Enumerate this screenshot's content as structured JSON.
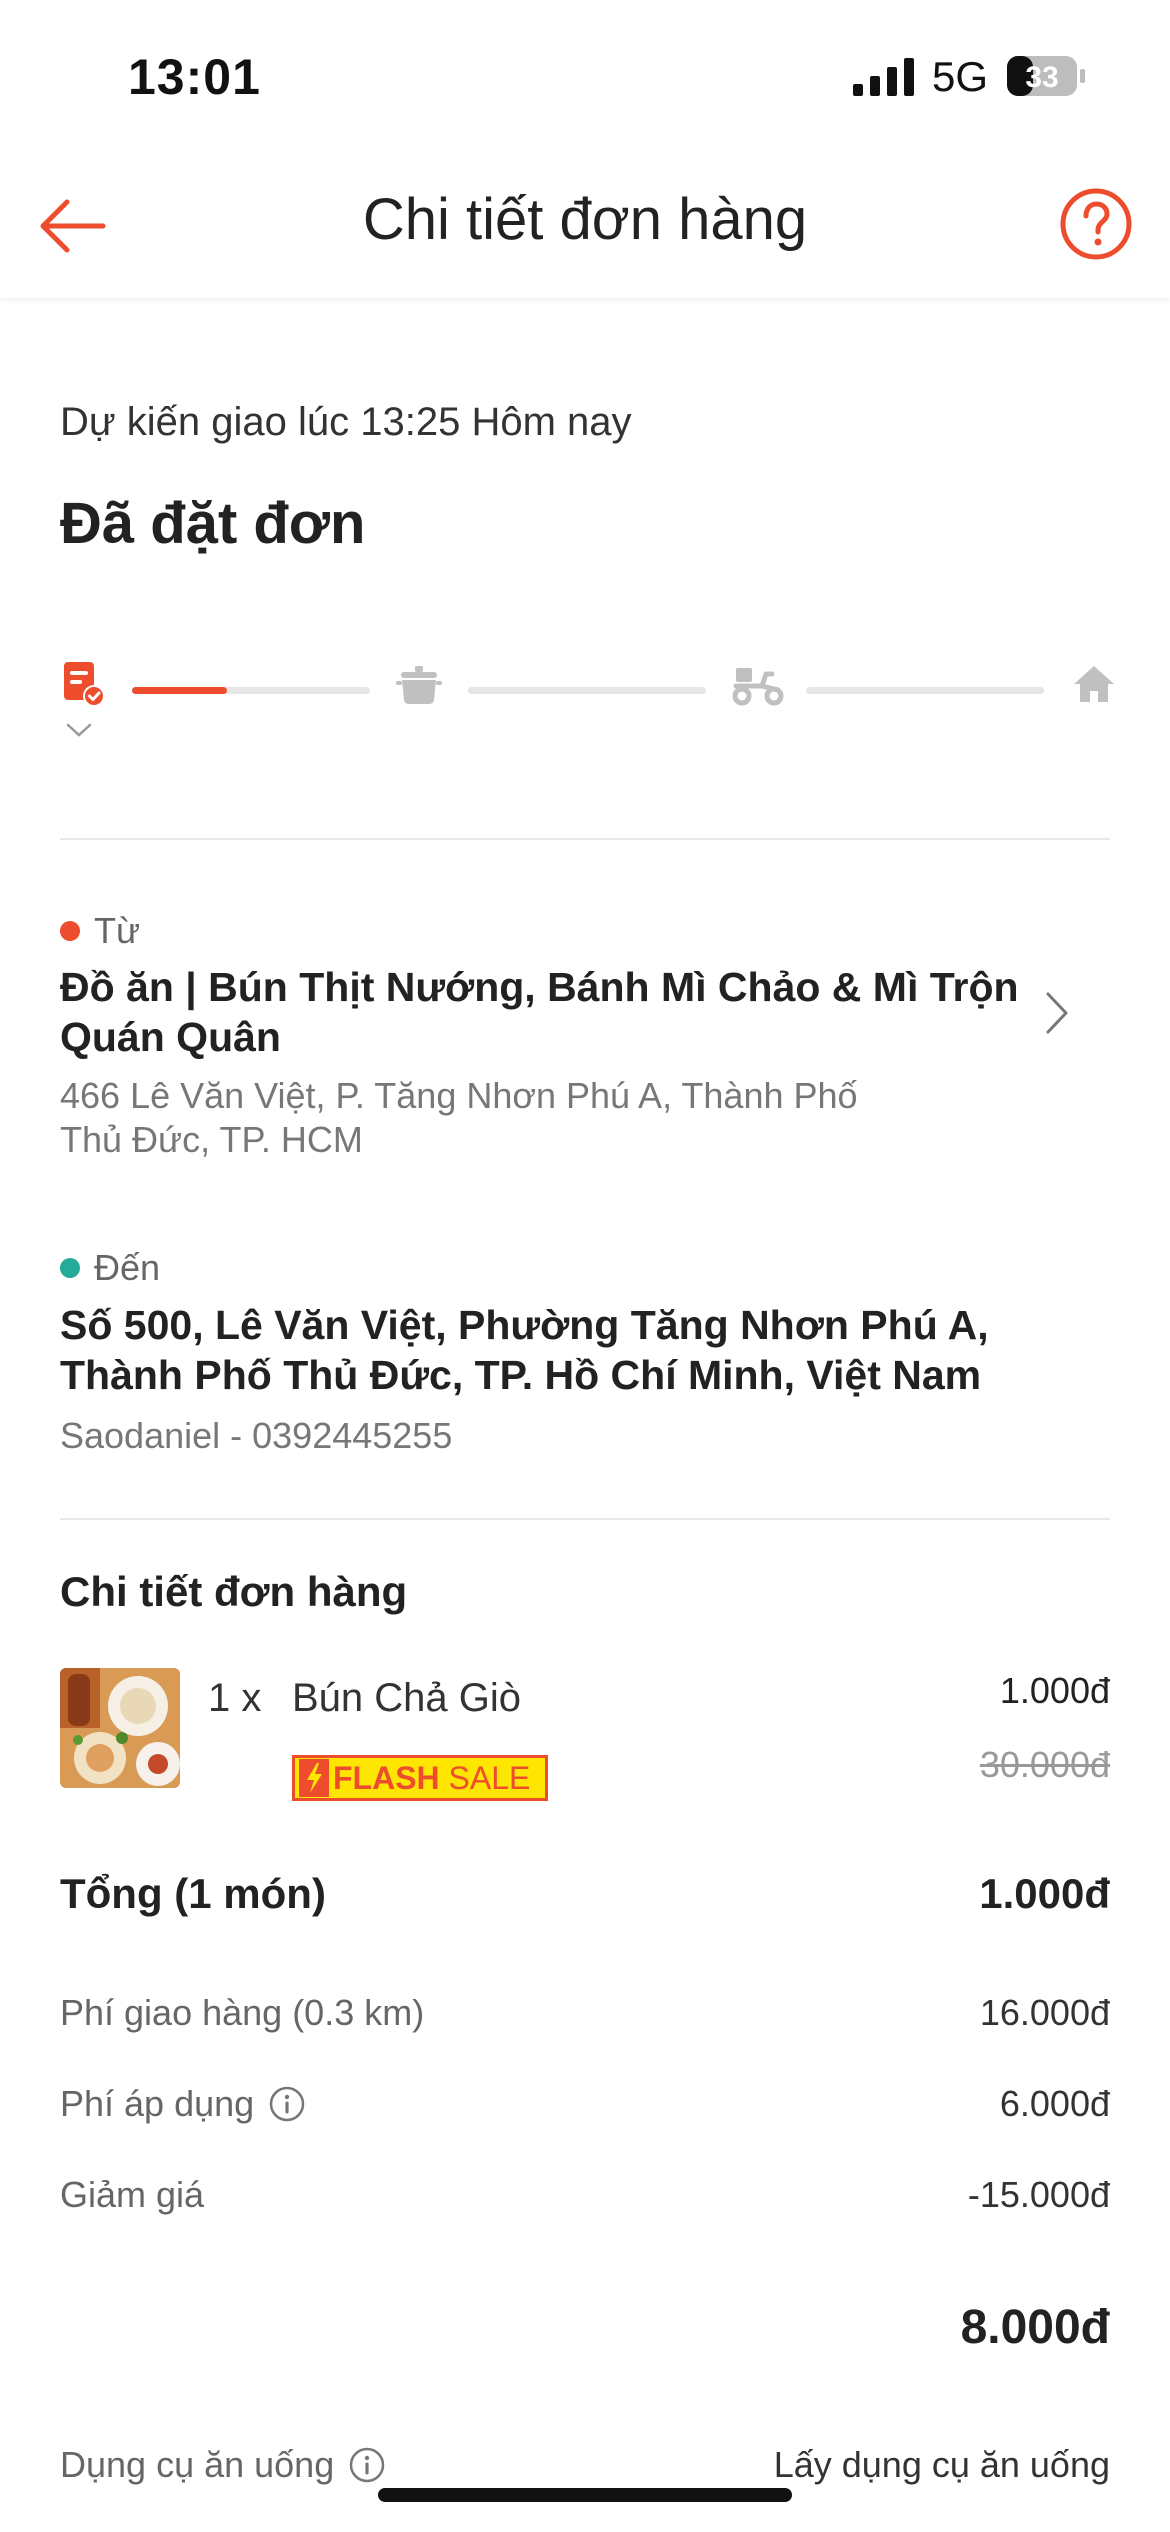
{
  "status_bar": {
    "time": "13:01",
    "network": "5G",
    "battery": "33"
  },
  "header": {
    "title": "Chi tiết đơn hàng"
  },
  "order": {
    "eta": "Dự kiến giao lúc 13:25 Hôm nay",
    "status": "Đã đặt đơn",
    "progress_fraction_first_segment": 0.4
  },
  "from": {
    "label": "Từ",
    "name": "Đồ ăn | Bún Thịt Nướng, Bánh Mì Chảo & Mì Trộn Quán Quân",
    "address": "466 Lê Văn Việt, P. Tăng Nhơn Phú A, Thành Phố Thủ Đức, TP. HCM"
  },
  "to": {
    "label": "Đến",
    "address": "Số 500, Lê Văn Việt, Phường Tăng Nhơn Phú A, Thành Phố Thủ Đức, TP. Hồ Chí Minh, Việt Nam",
    "contact": "Saodaniel - 0392445255"
  },
  "details": {
    "title": "Chi tiết đơn hàng",
    "item": {
      "qty": "1 x",
      "name": "Bún Chả Giò",
      "price": "1.000đ",
      "old_price": "30.000đ",
      "badge_flash": "FLASH",
      "badge_sale": "SALE"
    },
    "total_label": "Tổng (1 món)",
    "total_value": "1.000đ",
    "fees": [
      {
        "label": "Phí giao hàng (0.3 km)",
        "value": "16.000đ"
      },
      {
        "label": "Phí áp dụng",
        "value": "6.000đ"
      },
      {
        "label": "Giảm giá",
        "value": "-15.000đ"
      }
    ],
    "grand_total": "8.000đ",
    "utensils_label": "Dụng cụ ăn uống",
    "utensils_value": "Lấy dụng cụ ăn uống"
  },
  "colors": {
    "accent": "#ee4d2d",
    "teal": "#26aa99",
    "badge_yellow": "#ffe600"
  }
}
